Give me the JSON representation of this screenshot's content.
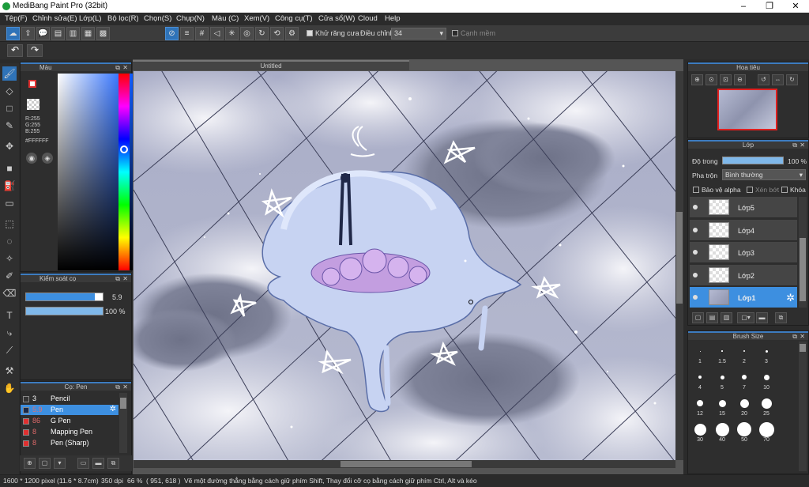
{
  "window": {
    "title": "MediBang Paint Pro (32bit)",
    "min": "–",
    "max": "❐",
    "close": "✕"
  },
  "menu": [
    "Tệp(F)",
    "Chỉnh sửa(E)",
    "Lớp(L)",
    "Bộ lọc(R)",
    "Chọn(S)",
    "Chụp(N)",
    "Màu (C)",
    "Xem(V)",
    "Công cụ(T)",
    "Cửa sổ(W)",
    "Cloud",
    "Help"
  ],
  "toolbar": {
    "antialias_label": "Khử răng cưa",
    "adjust_label": "Điều chỉnh",
    "adjust_value": "34",
    "edge_label": "Cạnh mềm"
  },
  "document": {
    "tab_title": "Untitled"
  },
  "color_panel": {
    "title": "Màu",
    "r": "R:255",
    "g": "G:255",
    "b": "B:255",
    "hex": "#FFFFFF"
  },
  "brush_control": {
    "title": "Kiểm soát cọ",
    "size_value": "5.9",
    "opacity_value": "100 %",
    "size_fraction": 0.9,
    "opacity_fraction": 1.0
  },
  "brush_list": {
    "title": "Cọ: Pen",
    "items": [
      {
        "num": "3",
        "name": "Pencil",
        "color": "#333333",
        "selected": false
      },
      {
        "num": "5.9",
        "name": "Pen",
        "color": "#1a2a4a",
        "selected": true
      },
      {
        "num": "86",
        "name": "G Pen",
        "color": "#e03030",
        "selected": false
      },
      {
        "num": "8",
        "name": "Mapping Pen",
        "color": "#e03030",
        "selected": false
      },
      {
        "num": "8",
        "name": "Pen (Sharp)",
        "color": "#e03030",
        "selected": false
      }
    ]
  },
  "navigator": {
    "title": "Hoa tiêu"
  },
  "layer_panel": {
    "title": "Lớp",
    "opacity_label": "Độ trong",
    "opacity_value": "100 %",
    "opacity_fraction": 1.0,
    "blend_label": "Pha trộn",
    "blend_value": "Bình thường",
    "protect_alpha": "Bảo vệ alpha",
    "clipping": "Xén bớt",
    "lock": "Khóa",
    "layers": [
      {
        "name": "Lớp5",
        "selected": false
      },
      {
        "name": "Lớp4",
        "selected": false
      },
      {
        "name": "Lớp3",
        "selected": false
      },
      {
        "name": "Lớp2",
        "selected": false
      },
      {
        "name": "Lớp1",
        "selected": true
      }
    ]
  },
  "brush_size": {
    "title": "Brush Size",
    "sizes": [
      "1",
      "1.5",
      "2",
      "3",
      "4",
      "5",
      "7",
      "10",
      "12",
      "15",
      "20",
      "25",
      "30",
      "40",
      "50",
      "70"
    ]
  },
  "status": {
    "dims": "1600 * 1200 pixel",
    "inches": "(11.6 * 8.7cm)",
    "dpi": "350 dpi",
    "zoom": "66 %",
    "coords": "( 951, 618 )",
    "hint": "Vẽ một đường thẳng bằng cách giữ phím Shift, Thay đổi cỡ cọ bằng cách giữ phím Ctrl, Alt và kéo"
  },
  "colors": {
    "accent": "#3d8fe0",
    "primary": "#ffffff",
    "secondary": "#e03030"
  }
}
